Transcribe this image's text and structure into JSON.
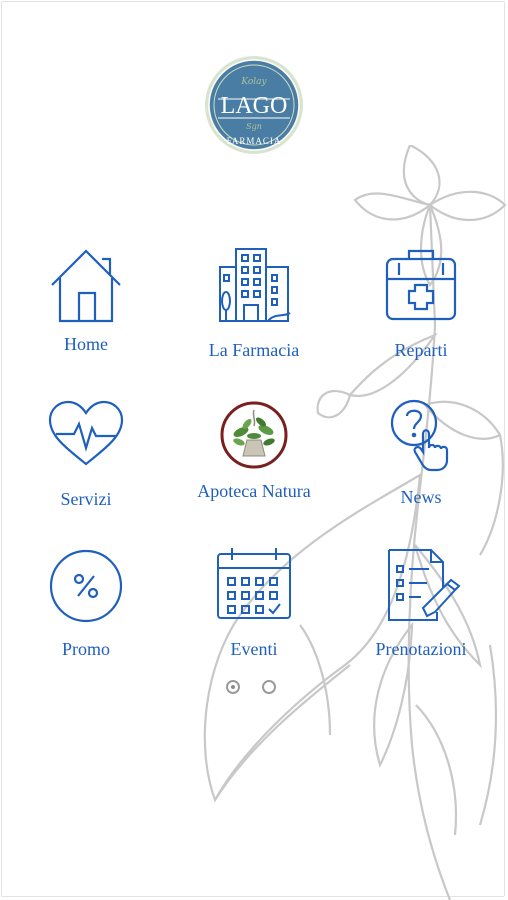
{
  "logo": {
    "title": "LAGO",
    "subtitle": "FARMACIA",
    "script_top": "Kolay",
    "script_bottom": "Sgn"
  },
  "menu": [
    {
      "label": "Home",
      "icon": "house-icon"
    },
    {
      "label": "La Farmacia",
      "icon": "building-icon"
    },
    {
      "label": "Reparti",
      "icon": "first-aid-kit-icon"
    },
    {
      "label": "Servizi",
      "icon": "heart-pulse-icon"
    },
    {
      "label": "Apoteca Natura",
      "icon": "apoteca-natura-logo"
    },
    {
      "label": "News",
      "icon": "question-touch-icon"
    },
    {
      "label": "Promo",
      "icon": "percent-icon"
    },
    {
      "label": "Eventi",
      "icon": "calendar-icon"
    },
    {
      "label": "Prenotazioni",
      "icon": "form-pencil-icon"
    }
  ],
  "pagination": {
    "pages": 2,
    "current": 1
  },
  "colors": {
    "accent": "#1f5fbd",
    "logo_bg": "#4a7da3",
    "logo_ring": "#d9e4d0",
    "apoteca_ring": "#7a1f1f",
    "flower_line": "#c8c8c8"
  }
}
